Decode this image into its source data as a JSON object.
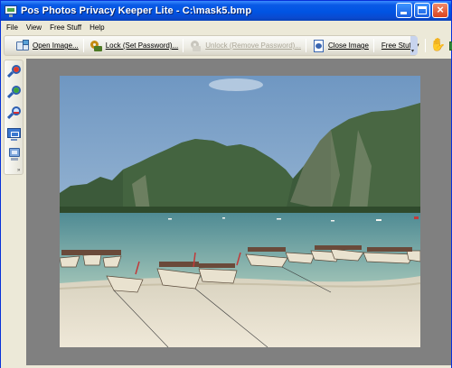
{
  "window": {
    "title": "Pos Photos Privacy Keeper Lite - C:\\mask5.bmp",
    "app_icon": "monitor-icon"
  },
  "menu": {
    "items": [
      "File",
      "View",
      "Free Stuff",
      "Help"
    ]
  },
  "toolbar": {
    "open": {
      "label": "Open Image...",
      "icon": "open-image-icon"
    },
    "lock": {
      "label": "Lock (Set Password)...",
      "icon": "lock-key-icon"
    },
    "unlock": {
      "label": "Unlock (Remove Password)...",
      "icon": "unlock-key-icon",
      "enabled": false
    },
    "close": {
      "label": "Close Image",
      "icon": "close-image-icon"
    },
    "free": {
      "label": "Free Stuff",
      "icon": "dropdown-arrow-icon"
    },
    "hand": {
      "icon": "hand-pan-icon"
    },
    "extra": {
      "icon": "green-app-icon"
    }
  },
  "sidebar": {
    "tools": [
      "zoom-in-icon",
      "zoom-area-icon",
      "zoom-out-icon",
      "fit-screen-icon",
      "actual-size-icon"
    ]
  },
  "image": {
    "description_icon": "beach-longtail-boats-photo",
    "colors": {
      "sky": "#8fb0cf",
      "water": "#6d9b9a",
      "sand": "#e9e1d0",
      "cliffs": "#3f5b3a"
    }
  }
}
